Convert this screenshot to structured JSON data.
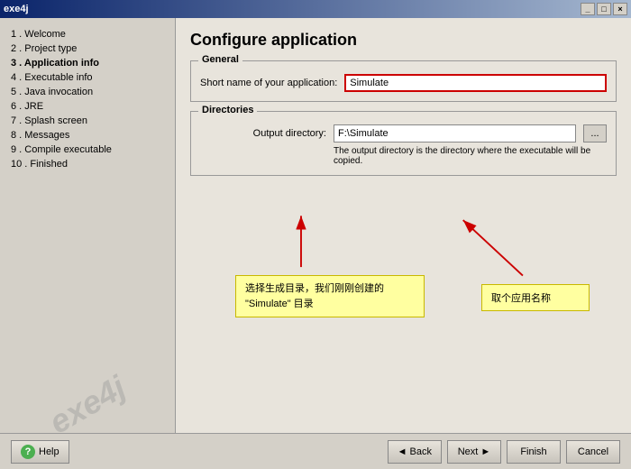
{
  "titlebar": {
    "title": "exe4j",
    "buttons": [
      "_",
      "□",
      "×"
    ]
  },
  "sidebar": {
    "items": [
      {
        "label": "1 . Welcome",
        "active": false
      },
      {
        "label": "2 . Project type",
        "active": false
      },
      {
        "label": "3 . Application info",
        "active": true
      },
      {
        "label": "4 . Executable info",
        "active": false
      },
      {
        "label": "5 . Java invocation",
        "active": false
      },
      {
        "label": "6 . JRE",
        "active": false
      },
      {
        "label": "7 . Splash screen",
        "active": false
      },
      {
        "label": "8 . Messages",
        "active": false
      },
      {
        "label": "9 . Compile executable",
        "active": false
      },
      {
        "label": "10 . Finished",
        "active": false
      }
    ],
    "watermark": "exe4j"
  },
  "content": {
    "title": "Configure application",
    "general_group_label": "General",
    "short_name_label": "Short name of your application:",
    "short_name_value": "Simulate",
    "directories_group_label": "Directories",
    "output_dir_label": "Output directory:",
    "output_dir_value": "F:\\Simulate",
    "browse_label": "...",
    "hint_text": "The output directory is the directory where the executable will be copied.",
    "callout_left": "选择生成目录，我们刚刚创建的\n\"Simulate\" 目录",
    "callout_right": "取个应用名称"
  },
  "bottom": {
    "help_label": "Help",
    "back_label": "◄  Back",
    "next_label": "Next  ►",
    "finish_label": "Finish",
    "cancel_label": "Cancel"
  }
}
